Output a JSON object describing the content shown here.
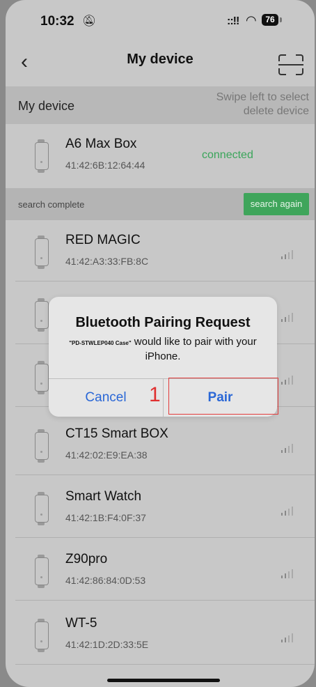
{
  "status_bar": {
    "time": "10:32",
    "signal": "::!!",
    "battery": "76"
  },
  "nav": {
    "title": "My device"
  },
  "my_device_section": {
    "title": "My device",
    "hint_line1": "Swipe left to select",
    "hint_line2": "delete device"
  },
  "connected_device": {
    "name": "A6 Max Box",
    "mac": "41:42:6B:12:64:44",
    "status": "connected"
  },
  "search_section": {
    "label": "search complete",
    "button": "search again"
  },
  "found_devices": [
    {
      "name": "RED MAGIC",
      "mac": "41:42:A3:33:FB:8C"
    },
    {
      "name": "",
      "mac": ""
    },
    {
      "name": "",
      "mac": ""
    },
    {
      "name": "CT15 Smart BOX",
      "mac": "41:42:02:E9:EA:38"
    },
    {
      "name": "Smart Watch",
      "mac": "41:42:1B:F4:0F:37"
    },
    {
      "name": "Z90pro",
      "mac": "41:42:86:84:0D:53"
    },
    {
      "name": "WT-5",
      "mac": "41:42:1D:2D:33:5E"
    }
  ],
  "dialog": {
    "title": "Bluetooth Pairing Request",
    "device_name": "\"PD-STWLEP040 Case\"",
    "message_rest": " would like to pair with your iPhone.",
    "cancel": "Cancel",
    "pair": "Pair"
  },
  "annotation": {
    "step": "1",
    "color": "#e23b3b"
  },
  "colors": {
    "accent_blue": "#2a67d6",
    "connected_green": "#3aa55a",
    "search_button": "#3fa55b"
  }
}
